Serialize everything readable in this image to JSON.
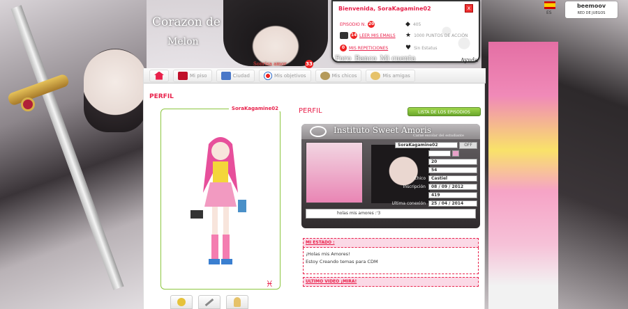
{
  "site": {
    "title_line1": "Corazon de",
    "title_line2": "Melon",
    "quote_text": "Sonrisa amor",
    "quote_count": "33"
  },
  "userpanel": {
    "welcome": "Bienvenida, SoraKagamine02",
    "close": "x",
    "episode_label": "EPISODIO N.",
    "episode_num": "20",
    "mail_count": "14",
    "mail_label": "LEER MIS EMAILS",
    "rep_count": "0",
    "rep_label": "MIS REPETICIONES",
    "stat1": "405",
    "stat2": "1000 PUNTOS DE ACCIÓN",
    "stat3": "Sin Estatus"
  },
  "panel_links": [
    "Foro",
    "Banco",
    "Mi cuenta"
  ],
  "help": "Ayuda",
  "lang": {
    "code": "ES"
  },
  "beemoov": {
    "line1": "beemoov",
    "line2": "RED DE JUEGOS"
  },
  "nav": [
    {
      "label": "",
      "icon": "home-icon",
      "color": "#e8204a"
    },
    {
      "label": "Mi piso",
      "icon": "sofa-icon",
      "color": "#c0102a"
    },
    {
      "label": "Ciudad",
      "icon": "city-icon",
      "color": "#4a78c8"
    },
    {
      "label": "Mis objetivos",
      "icon": "target-icon",
      "color": "#2a66c8"
    },
    {
      "label": "Mis chicos",
      "icon": "boy-icon",
      "color": "#b59a5a"
    },
    {
      "label": "Mis amigas",
      "icon": "girl-icon",
      "color": "#e6c26a"
    }
  ],
  "page_title": "PERFIL",
  "avatar": {
    "name": "SoraKagamine02",
    "zodiac": "♓"
  },
  "profile_label": "PERFIL",
  "episodes_button": "LISTA DE LOS EPISODIOS",
  "idcard": {
    "title": "Instituto Sweet Amoris",
    "subtitle": "Carné escolar del estudiante",
    "off": "OFF",
    "rows": [
      {
        "label": "",
        "value": "SoraKagamine02"
      },
      {
        "label": "",
        "value": ""
      },
      {
        "label": "",
        "value": "20"
      },
      {
        "label": "",
        "value": "54"
      },
      {
        "label": "Chico",
        "value": "Castiel"
      },
      {
        "label": "Inscripción",
        "value": "08 / 09 / 2012"
      },
      {
        "label": "",
        "value": "419"
      },
      {
        "label": "Ultima conexión",
        "value": "25 / 04 / 2014"
      }
    ],
    "status": "holas mis amores :'3"
  },
  "estado": {
    "header": "MI ESTADO :",
    "line1": "¡Holas mis Amores!",
    "line2": "Estoy Creando temas para CDM"
  },
  "video": {
    "header": "ULTIMO VIDEO ¡MIRA!"
  }
}
